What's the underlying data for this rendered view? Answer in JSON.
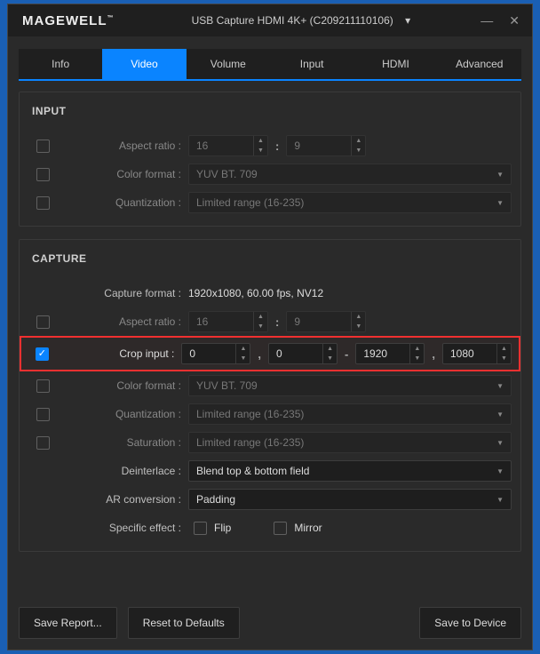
{
  "titlebar": {
    "logo": "MAGEWELL",
    "tm": "™",
    "device": "USB Capture HDMI 4K+ (C209211110106)"
  },
  "tabs": {
    "info": "Info",
    "video": "Video",
    "volume": "Volume",
    "input": "Input",
    "hdmi": "HDMI",
    "advanced": "Advanced"
  },
  "sections": {
    "input": {
      "title": "INPUT",
      "aspect_ratio_label": "Aspect ratio :",
      "aspect_w": "16",
      "aspect_h": "9",
      "color_format_label": "Color format :",
      "color_format_value": "YUV BT. 709",
      "quantization_label": "Quantization :",
      "quantization_value": "Limited range (16-235)"
    },
    "capture": {
      "title": "CAPTURE",
      "capture_format_label": "Capture format :",
      "capture_format_value": "1920x1080, 60.00 fps, NV12",
      "aspect_ratio_label": "Aspect ratio :",
      "aspect_w": "16",
      "aspect_h": "9",
      "crop_input_label": "Crop input :",
      "crop_x": "0",
      "crop_y": "0",
      "crop_w": "1920",
      "crop_h": "1080",
      "color_format_label": "Color format :",
      "color_format_value": "YUV BT. 709",
      "quantization_label": "Quantization :",
      "quantization_value": "Limited range (16-235)",
      "saturation_label": "Saturation :",
      "saturation_value": "Limited range (16-235)",
      "deinterlace_label": "Deinterlace :",
      "deinterlace_value": "Blend top & bottom field",
      "ar_conversion_label": "AR conversion :",
      "ar_conversion_value": "Padding",
      "specific_effect_label": "Specific effect :",
      "flip_label": "Flip",
      "mirror_label": "Mirror"
    }
  },
  "footer": {
    "save_report": "Save Report...",
    "reset_defaults": "Reset to Defaults",
    "save_device": "Save to Device"
  }
}
